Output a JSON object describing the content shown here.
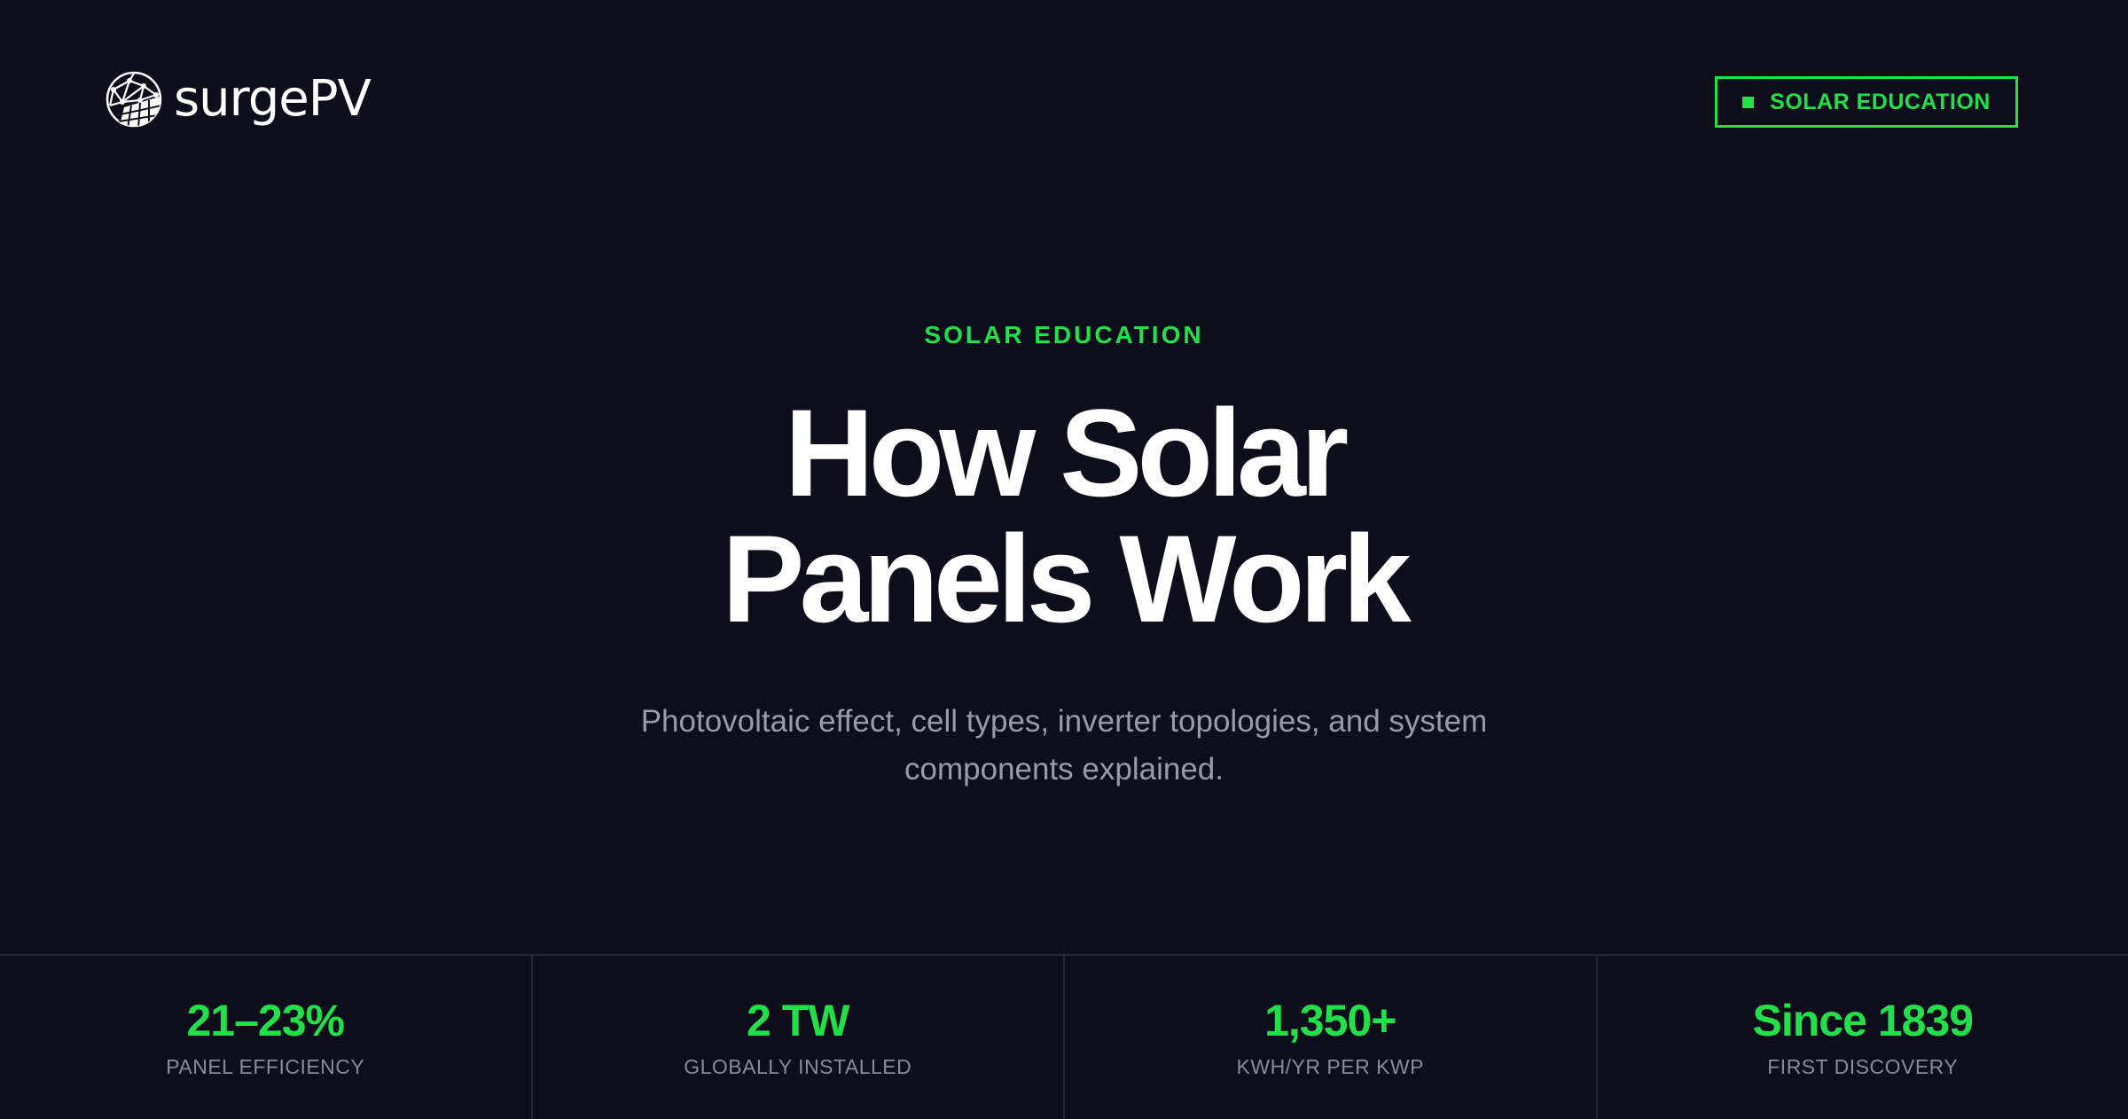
{
  "header": {
    "logo_text": "surgePV",
    "logo_icon": "solar-globe-icon",
    "badge_label": "SOLAR EDUCATION"
  },
  "hero": {
    "eyebrow": "SOLAR EDUCATION",
    "title_line1": "How Solar",
    "title_line2": "Panels Work",
    "subtitle_line1": "Photovoltaic effect, cell types, inverter topologies, and system",
    "subtitle_line2": "components explained."
  },
  "stats": [
    {
      "value": "21–23%",
      "label": "PANEL EFFICIENCY"
    },
    {
      "value": "2 TW",
      "label": "GLOBALLY INSTALLED"
    },
    {
      "value": "1,350+",
      "label": "KWH/YR PER KWP"
    },
    {
      "value": "Since 1839",
      "label": "FIRST DISCOVERY"
    }
  ],
  "colors": {
    "background": "#0d0d1c",
    "accent": "#22e04a",
    "text": "#ffffff",
    "muted": "#9a9aaa",
    "divider": "#24243a"
  }
}
